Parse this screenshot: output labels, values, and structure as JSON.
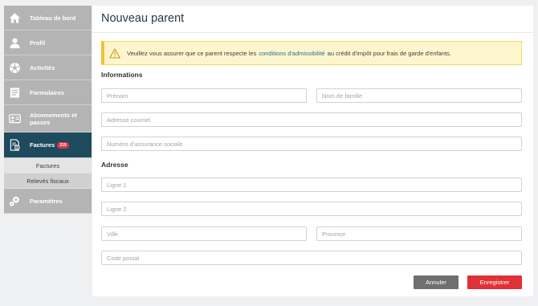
{
  "sidebar": {
    "items": [
      {
        "label": "Tableau de bord",
        "icon": "home-icon"
      },
      {
        "label": "Profil",
        "icon": "user-icon"
      },
      {
        "label": "Activités",
        "icon": "soccer-ball-icon"
      },
      {
        "label": "Formulaires",
        "icon": "form-icon"
      },
      {
        "label": "Abonnements et passes",
        "icon": "id-card-icon"
      },
      {
        "label": "Factures",
        "icon": "invoice-icon",
        "badge": "219"
      },
      {
        "label": "Paramètres",
        "icon": "gears-icon"
      }
    ],
    "subitems": [
      {
        "label": "Factures"
      },
      {
        "label": "Relevés fiscaux"
      }
    ]
  },
  "page": {
    "title": "Nouveau parent"
  },
  "alert": {
    "icon": "warning-icon",
    "text_before": "Veuillez vous assurer que ce parent respecte les",
    "link": "conditions d'admissibilité",
    "text_after": "au crédit d'impôt pour frais de garde d'enfants."
  },
  "sections": {
    "informations": "Informations",
    "adresse": "Adresse"
  },
  "fields": {
    "prenom": {
      "placeholder": "Prénom",
      "value": ""
    },
    "nom": {
      "placeholder": "Nom de famille",
      "value": ""
    },
    "courriel": {
      "placeholder": "Adresse courriel",
      "value": ""
    },
    "nas": {
      "placeholder": "Numéro d'assurance sociale",
      "value": ""
    },
    "ligne1": {
      "placeholder": "Ligne 1",
      "value": ""
    },
    "ligne2": {
      "placeholder": "Ligne 2",
      "value": ""
    },
    "ville": {
      "placeholder": "Ville",
      "value": ""
    },
    "province": {
      "placeholder": "Province",
      "value": ""
    },
    "code_postal": {
      "placeholder": "Code postal",
      "value": ""
    }
  },
  "buttons": {
    "cancel": "Annuler",
    "save": "Enregistrer"
  },
  "colors": {
    "sidebar_bg": "#b4b4b4",
    "sidebar_active": "#1e4a5d",
    "badge": "#d9363e",
    "alert_bg": "#fdf6cd",
    "alert_border": "#efc52e",
    "link": "#2a6f91",
    "cancel_button": "#6f6f6f",
    "save_button": "#df3236"
  }
}
